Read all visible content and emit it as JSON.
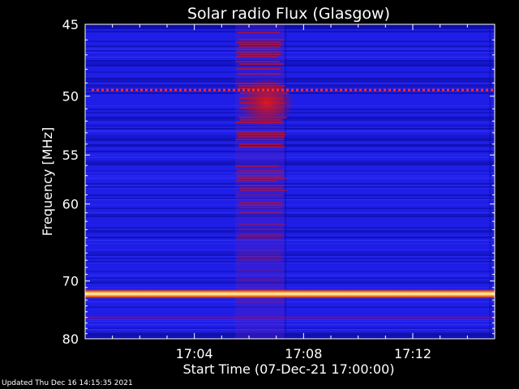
{
  "chart_data": {
    "type": "heatmap",
    "title": "Solar radio Flux (Glasgow)",
    "xlabel": "Start Time (07-Dec-21 17:00:00)",
    "ylabel": "Frequency [MHz]",
    "x_ticks": [
      "17:04",
      "17:08",
      "17:12"
    ],
    "x_tick_minutes": [
      4,
      8,
      12
    ],
    "x_range_minutes": [
      0,
      15
    ],
    "y_ticks": [
      45,
      50,
      55,
      60,
      70,
      80
    ],
    "y_range": [
      45,
      80
    ],
    "y_scale": "log",
    "bands": [
      {
        "freq_mhz": 49.5,
        "kind": "dotted-line",
        "color": "#ff2a2a"
      },
      {
        "freq_mhz": 72.0,
        "kind": "bright-line",
        "color": "#ffff60"
      },
      {
        "freq_mhz": 76.0,
        "kind": "faint-line",
        "color": "#c00040"
      }
    ],
    "activity_region": {
      "start_minute": 5.5,
      "end_minute": 7.3,
      "peak_freq_mhz": 50.5
    },
    "colors": {
      "background": "#000000",
      "base": "#1e1ee6",
      "dark": "#0a0a9a",
      "hot": "#d01010",
      "warm": "#ff8000",
      "peak": "#ffffff",
      "text": "#ffffff"
    }
  },
  "footer": {
    "updated_text": "Updated Thu Dec 16 14:15:35 2021"
  }
}
